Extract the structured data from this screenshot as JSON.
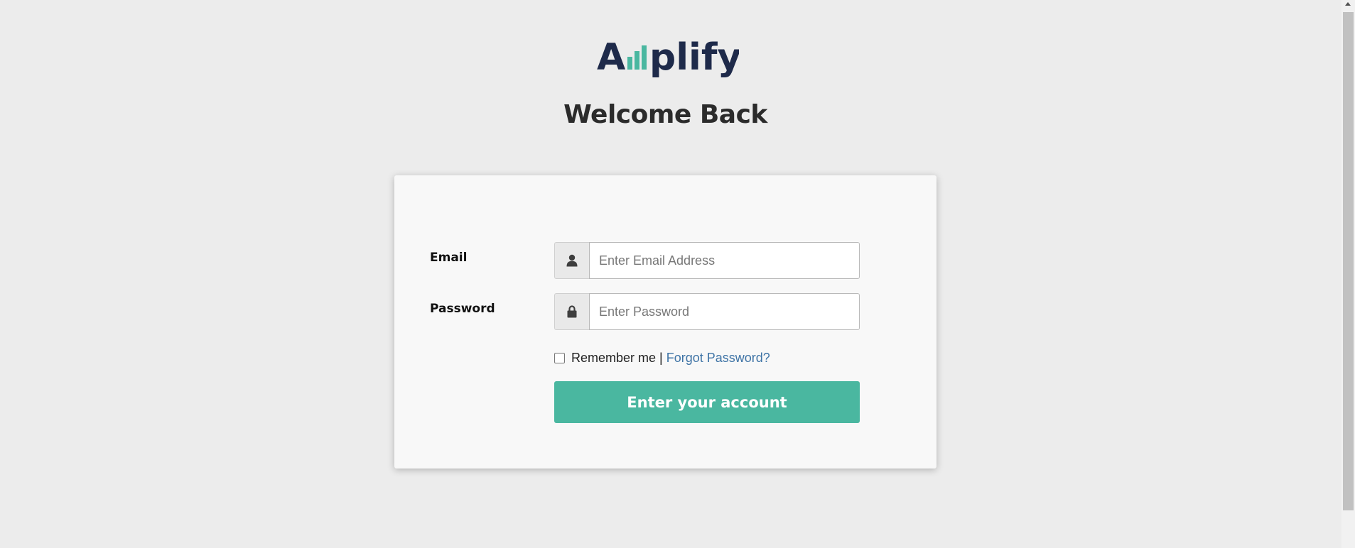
{
  "brand": {
    "logo_text_left": "A",
    "logo_text_right": "plify",
    "primary_color": "#1e2a4a",
    "accent_color": "#4ab7a0"
  },
  "header": {
    "title": "Welcome Back"
  },
  "form": {
    "email_label": "Email",
    "email_placeholder": "Enter Email Address",
    "email_value": "",
    "email_icon": "user-icon",
    "password_label": "Password",
    "password_placeholder": "Enter Password",
    "password_value": "",
    "password_icon": "lock-icon",
    "remember_label": "Remember me",
    "separator": "|",
    "remember_checked": false,
    "forgot_link": "Forgot Password?",
    "submit_label": "Enter your account"
  }
}
